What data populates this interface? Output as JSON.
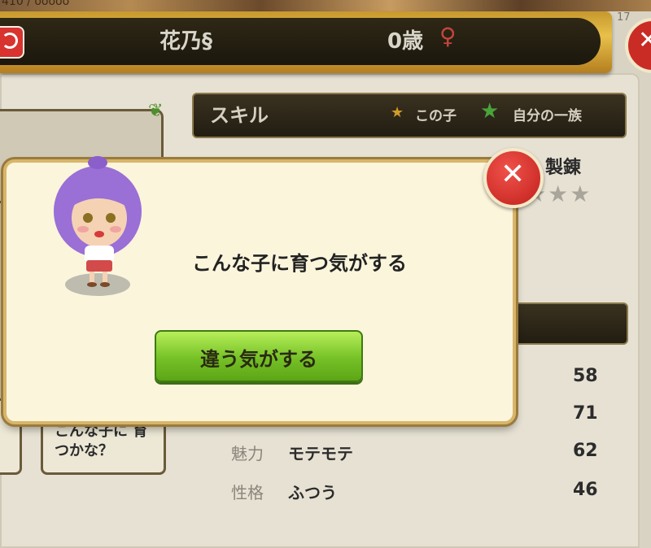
{
  "header": {
    "top_partial_text": "410 / ooooo",
    "page_num": "17",
    "name": "花乃§",
    "age": "0歳",
    "gender_symbol": "♀"
  },
  "skill_panel": {
    "title": "スキル",
    "this_child_label": "この子",
    "family_label": "自分の一族",
    "visible_skill": "製錬",
    "skill_rating_stars": 0
  },
  "stats": [
    {
      "label": "",
      "value": "",
      "number": "58"
    },
    {
      "label": "",
      "value": "",
      "number": "71"
    },
    {
      "label": "魅力",
      "value": "モテモテ",
      "number": "62"
    },
    {
      "label": "性格",
      "value": "ふつう",
      "number": "46"
    }
  ],
  "grow_button": {
    "label": "こんな子に 育つかな？"
  },
  "dialog": {
    "message": "こんな子に育つ気がする",
    "button_label": "違う気がする"
  },
  "colors": {
    "dialog_bg": "#fbf5dc",
    "button_green": "#75c126",
    "close_red": "#c92c25"
  }
}
